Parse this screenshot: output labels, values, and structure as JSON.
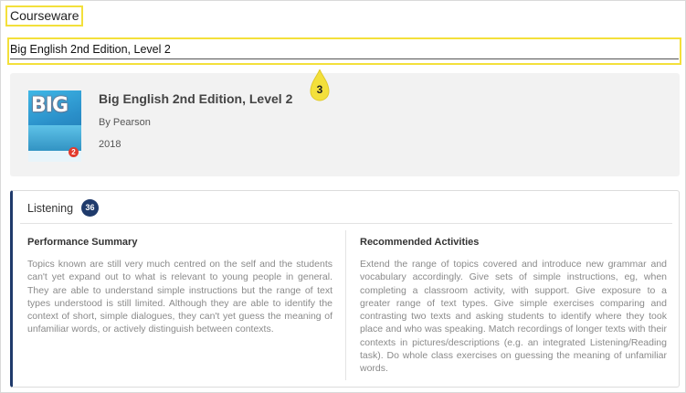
{
  "page": {
    "title": "Courseware"
  },
  "selector": {
    "value": "Big English 2nd Edition, Level 2"
  },
  "callout": {
    "number": "3",
    "color": "#f3e03b"
  },
  "book": {
    "title": "Big English 2nd Edition, Level 2",
    "publisher": "By Pearson",
    "year": "2018",
    "cover_text": "BIG",
    "cover_level": "2"
  },
  "skill": {
    "name": "Listening",
    "score": "36",
    "accent_color": "#1f3a6b",
    "performance_summary": {
      "heading": "Performance Summary",
      "text": "Topics known are still very much centred on the self and the students can't yet expand out to what is relevant to young people in general. They are able to understand simple instructions but the range of text types understood is still limited. Although they are able to identify the context of short, simple dialogues, they can't yet guess the meaning of unfamiliar words, or actively distinguish between contexts."
    },
    "recommended_activities": {
      "heading": "Recommended Activities",
      "text": "Extend the range of topics covered and introduce new grammar and vocabulary accordingly. Give sets of simple instructions, eg, when completing a classroom activity, with support. Give exposure to a greater range of text types. Give simple exercises comparing and contrasting two texts and asking students to identify where they took place and who was speaking. Match recordings of longer texts with their contexts in pictures/descriptions (e.g. an integrated Listening/Reading task). Do whole class exercises on guessing the meaning of unfamiliar words."
    }
  }
}
